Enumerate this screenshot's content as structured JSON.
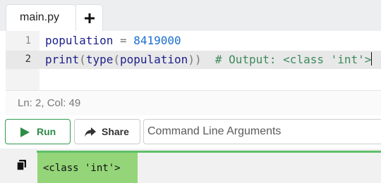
{
  "tabs": [
    {
      "label": "main.py"
    }
  ],
  "editor": {
    "lines": [
      {
        "number": "1",
        "tokens": [
          {
            "text": "population",
            "kind": "plain"
          },
          {
            "text": " = ",
            "kind": "op"
          },
          {
            "text": "8419000",
            "kind": "num"
          }
        ]
      },
      {
        "number": "2",
        "tokens": [
          {
            "text": "print",
            "kind": "plain"
          },
          {
            "text": "(",
            "kind": "op"
          },
          {
            "text": "type",
            "kind": "plain"
          },
          {
            "text": "(",
            "kind": "op"
          },
          {
            "text": "population",
            "kind": "plain"
          },
          {
            "text": "))",
            "kind": "op"
          },
          {
            "text": "  # Output: <class 'int'>",
            "kind": "comment"
          }
        ]
      }
    ],
    "status": "Ln: 2,  Col: 49"
  },
  "toolbar": {
    "run_label": "Run",
    "share_label": "Share",
    "args_placeholder": "Command Line Arguments"
  },
  "output": {
    "text": "<class 'int'>"
  },
  "colors": {
    "run_green": "#2e8b47",
    "output_highlight": "#93d578",
    "output_bar": "#5fbf6a"
  },
  "icons": {
    "add_tab": "plus-icon",
    "run": "play-icon",
    "share": "share-arrow-icon",
    "output_copy": "copy-icon"
  }
}
